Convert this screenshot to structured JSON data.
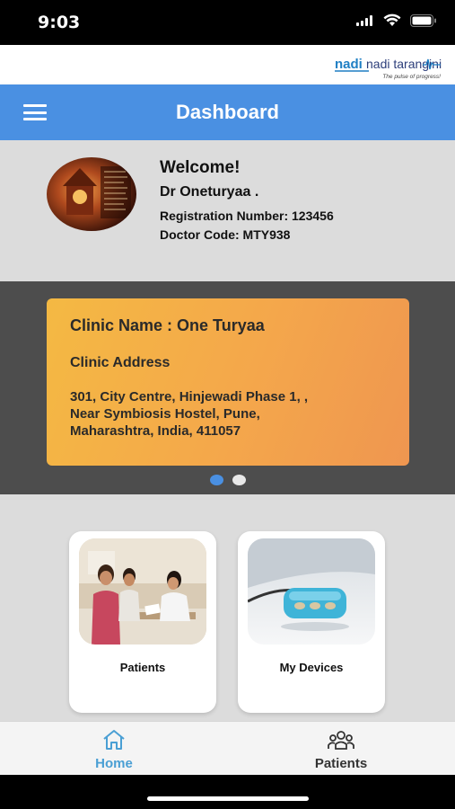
{
  "status_bar": {
    "time": "9:03"
  },
  "brand": {
    "logo_text": "nadi tarangini",
    "tagline": "The pulse of progress!",
    "accent_color": "#4a90e2"
  },
  "app_bar": {
    "title": "Dashboard",
    "menu_icon": "hamburger-icon"
  },
  "profile": {
    "welcome": "Welcome!",
    "doctor_name": "Dr Oneturyaa .",
    "registration": "Registration Number: 123456",
    "doctor_code": "Doctor Code: MTY938"
  },
  "clinic": {
    "name_line": "Clinic Name : One Turyaa",
    "address_label": "Clinic Address",
    "address_line1": "301, City Centre, Hinjewadi Phase 1, ,",
    "address_line2": "Near Symbiosis Hostel, Pune,",
    "address_line3": "Maharashtra, India, 411057"
  },
  "carousel": {
    "total": 2,
    "active": 1
  },
  "tiles": [
    {
      "label": "Patients",
      "image": "doctor-consultation-photo"
    },
    {
      "label": "My Devices",
      "image": "pulse-device-photo"
    }
  ],
  "bottom_nav": [
    {
      "label": "Home",
      "icon": "home-icon",
      "active": true,
      "color": "#4a9fd4"
    },
    {
      "label": "Patients",
      "icon": "patients-group-icon",
      "active": false,
      "color": "#333333"
    }
  ]
}
